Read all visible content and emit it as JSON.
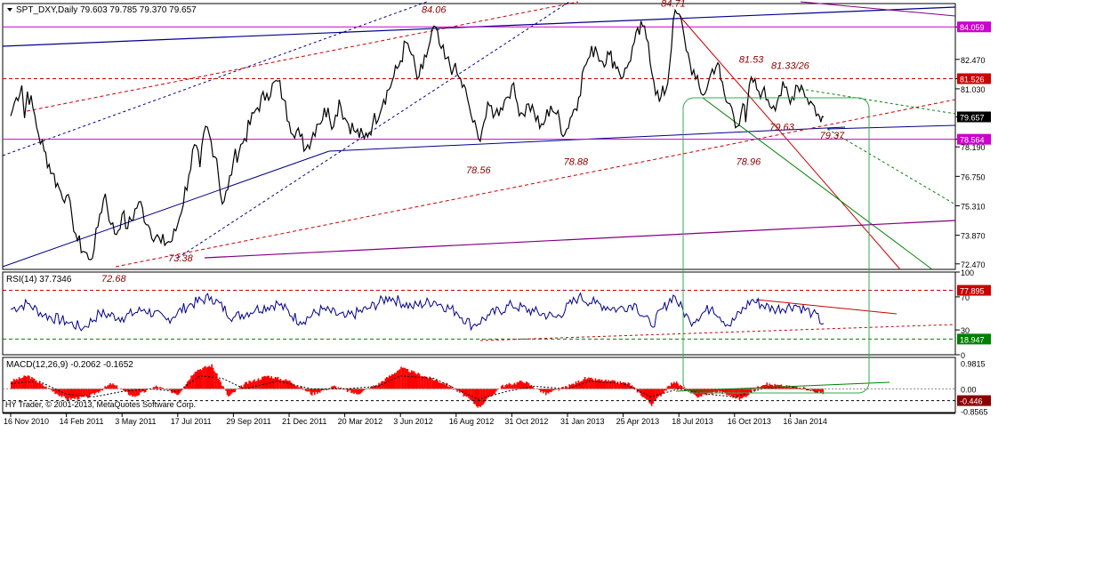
{
  "window": {
    "symbol_line": "SPT_DXY,Daily  79.603 79.785 79.370 79.657",
    "footer": "HY Trader, © 2001-2013, MetaQuotes Software Corp."
  },
  "colors": {
    "price": "#000000",
    "trend_blue": "#00008b",
    "trend_red": "#cc0000",
    "trend_green": "#008000",
    "magenta": "#cc00cc",
    "purple": "#800080",
    "box": "#33aa55",
    "macd_bars": "#ff0000",
    "annotation": "#8b0000"
  },
  "chart_data": [
    {
      "type": "line",
      "panel": "price",
      "title": "SPT_DXY,Daily  79.603 79.785 79.370 79.657",
      "x": [
        "16 Nov 2010",
        "14 Feb 2011",
        "3 May 2011",
        "17 Jul 2011",
        "29 Sep 2011",
        "21 Dec 2011",
        "20 Mar 2012",
        "3 Jun 2012",
        "16 Aug 2012",
        "31 Oct 2012",
        "31 Jan 2013",
        "25 Apr 2013",
        "18 Jul 2013",
        "16 Oct 2013",
        "16 Jan 2014"
      ],
      "ylim": [
        72.2,
        85.2
      ],
      "y_ticks": [
        "84.059",
        "82.470",
        "81.526",
        "81.030",
        "79.657",
        "78.564",
        "78.190",
        "76.750",
        "75.310",
        "73.870",
        "72.470"
      ],
      "highlighted_levels": [
        {
          "label": "84.059",
          "value": 84.059,
          "color": "#cc00cc"
        },
        {
          "label": "81.526",
          "value": 81.526,
          "color": "#cc0000"
        },
        {
          "label": "79.657",
          "value": 79.657,
          "color": "#000000"
        },
        {
          "label": "78.564",
          "value": 78.564,
          "color": "#cc00cc"
        }
      ],
      "series": [
        {
          "values": [
            [
              0,
              79.7
            ],
            [
              0.1,
              80.6
            ],
            [
              0.2,
              81.2
            ],
            [
              0.25,
              79.6
            ],
            [
              0.3,
              80.9
            ],
            [
              0.4,
              80.1
            ],
            [
              0.5,
              78.8
            ],
            [
              0.6,
              78.0
            ],
            [
              0.75,
              76.9
            ],
            [
              0.9,
              76.0
            ],
            [
              1.0,
              75.8
            ],
            [
              1.1,
              74.8
            ],
            [
              1.2,
              73.6
            ],
            [
              1.4,
              72.7
            ],
            [
              1.5,
              73.2
            ],
            [
              1.6,
              74.9
            ],
            [
              1.7,
              75.9
            ],
            [
              1.8,
              74.4
            ],
            [
              1.9,
              73.9
            ],
            [
              2.0,
              74.9
            ],
            [
              2.1,
              74.2
            ],
            [
              2.3,
              75.5
            ],
            [
              2.5,
              74.2
            ],
            [
              2.7,
              73.5
            ],
            [
              2.9,
              73.6
            ],
            [
              3.0,
              74.4
            ],
            [
              3.2,
              76.8
            ],
            [
              3.3,
              78.3
            ],
            [
              3.4,
              77.2
            ],
            [
              3.5,
              79.2
            ],
            [
              3.7,
              77.6
            ],
            [
              3.8,
              75.4
            ],
            [
              3.9,
              76.1
            ],
            [
              4.0,
              77.5
            ],
            [
              4.2,
              78.6
            ],
            [
              4.4,
              80.0
            ],
            [
              4.6,
              80.8
            ],
            [
              4.8,
              81.4
            ],
            [
              4.9,
              80.5
            ],
            [
              5.0,
              79.4
            ],
            [
              5.2,
              78.7
            ],
            [
              5.3,
              78.1
            ],
            [
              5.5,
              79.3
            ],
            [
              5.7,
              80.1
            ],
            [
              5.8,
              79.2
            ],
            [
              5.9,
              80.5
            ],
            [
              6.0,
              79.6
            ],
            [
              6.2,
              78.9
            ],
            [
              6.35,
              78.6
            ],
            [
              6.5,
              79.3
            ],
            [
              6.7,
              80.5
            ],
            [
              6.85,
              81.4
            ],
            [
              7.0,
              82.4
            ],
            [
              7.1,
              83.3
            ],
            [
              7.2,
              82.7
            ],
            [
              7.3,
              81.5
            ],
            [
              7.4,
              82.0
            ],
            [
              7.5,
              83.0
            ],
            [
              7.6,
              84.1
            ],
            [
              7.7,
              83.2
            ],
            [
              7.8,
              82.5
            ],
            [
              7.95,
              82.0
            ],
            [
              8.05,
              81.6
            ],
            [
              8.2,
              80.6
            ],
            [
              8.3,
              79.4
            ],
            [
              8.4,
              78.6
            ],
            [
              8.5,
              79.4
            ],
            [
              8.6,
              80.2
            ],
            [
              8.7,
              79.8
            ],
            [
              8.8,
              80.1
            ],
            [
              8.9,
              80.6
            ],
            [
              9.0,
              81.2
            ],
            [
              9.1,
              80.3
            ],
            [
              9.2,
              79.8
            ],
            [
              9.3,
              80.3
            ],
            [
              9.4,
              79.9
            ],
            [
              9.5,
              79.1
            ],
            [
              9.6,
              79.5
            ],
            [
              9.7,
              80.2
            ],
            [
              9.8,
              79.8
            ],
            [
              9.95,
              78.8
            ],
            [
              10.05,
              79.6
            ],
            [
              10.2,
              80.6
            ],
            [
              10.3,
              82.1
            ],
            [
              10.4,
              82.6
            ],
            [
              10.5,
              83.1
            ],
            [
              10.6,
              82.4
            ],
            [
              10.75,
              82.7
            ],
            [
              10.9,
              82.1
            ],
            [
              11.0,
              81.6
            ],
            [
              11.1,
              82.3
            ],
            [
              11.2,
              83.3
            ],
            [
              11.35,
              84.1
            ],
            [
              11.45,
              83.3
            ],
            [
              11.55,
              81.4
            ],
            [
              11.65,
              80.4
            ],
            [
              11.8,
              81.3
            ],
            [
              11.9,
              84.4
            ],
            [
              12.0,
              84.7
            ],
            [
              12.1,
              83.5
            ],
            [
              12.2,
              82.3
            ],
            [
              12.3,
              81.5
            ],
            [
              12.4,
              80.8
            ],
            [
              12.5,
              81.0
            ],
            [
              12.6,
              82.0
            ],
            [
              12.7,
              82.3
            ],
            [
              12.75,
              81.5
            ],
            [
              12.85,
              80.4
            ],
            [
              12.95,
              80.1
            ],
            [
              13.05,
              79.2
            ],
            [
              13.15,
              80.3
            ],
            [
              13.2,
              79.4
            ],
            [
              13.3,
              81.6
            ],
            [
              13.4,
              81.0
            ],
            [
              13.5,
              80.9
            ],
            [
              13.6,
              80.5
            ],
            [
              13.7,
              80.2
            ],
            [
              13.8,
              80.7
            ],
            [
              13.9,
              81.1
            ],
            [
              14.0,
              80.3
            ],
            [
              14.1,
              81.2
            ],
            [
              14.2,
              81.2
            ],
            [
              14.3,
              80.6
            ],
            [
              14.4,
              80.3
            ],
            [
              14.5,
              79.8
            ],
            [
              14.55,
              79.4
            ],
            [
              14.6,
              79.66
            ]
          ]
        }
      ],
      "annotations": [
        "84.06",
        "84.71",
        "81.53",
        "81.33/26",
        "79.63",
        "79.37",
        "78.56",
        "78.88",
        "78.96",
        "72.68",
        "73.38"
      ]
    },
    {
      "type": "line",
      "panel": "rsi",
      "title": "RSI(14) 37.7346",
      "ylim": [
        0,
        100
      ],
      "y_ticks": [
        "100",
        "70",
        "30",
        "0"
      ],
      "highlighted_levels": [
        {
          "label": "77.895",
          "value": 77.895,
          "color": "#cc0000"
        },
        {
          "label": "18.947",
          "value": 18.947,
          "color": "#008000"
        }
      ],
      "series": [
        {
          "values": [
            [
              0,
              55
            ],
            [
              0.3,
              62
            ],
            [
              0.6,
              48
            ],
            [
              1.0,
              40
            ],
            [
              1.3,
              32
            ],
            [
              1.6,
              50
            ],
            [
              2.0,
              45
            ],
            [
              2.4,
              55
            ],
            [
              2.8,
              42
            ],
            [
              3.2,
              60
            ],
            [
              3.6,
              70
            ],
            [
              4.0,
              45
            ],
            [
              4.4,
              55
            ],
            [
              4.8,
              62
            ],
            [
              5.2,
              40
            ],
            [
              5.6,
              55
            ],
            [
              6.0,
              45
            ],
            [
              6.4,
              55
            ],
            [
              6.8,
              70
            ],
            [
              7.2,
              58
            ],
            [
              7.6,
              65
            ],
            [
              8.0,
              52
            ],
            [
              8.3,
              35
            ],
            [
              8.6,
              48
            ],
            [
              9.0,
              60
            ],
            [
              9.4,
              52
            ],
            [
              9.8,
              45
            ],
            [
              10.2,
              70
            ],
            [
              10.5,
              62
            ],
            [
              10.9,
              55
            ],
            [
              11.2,
              62
            ],
            [
              11.5,
              35
            ],
            [
              11.9,
              72
            ],
            [
              12.2,
              40
            ],
            [
              12.6,
              58
            ],
            [
              12.9,
              35
            ],
            [
              13.3,
              66
            ],
            [
              13.7,
              55
            ],
            [
              14.1,
              60
            ],
            [
              14.4,
              50
            ],
            [
              14.6,
              37.7
            ]
          ]
        }
      ]
    },
    {
      "type": "bar",
      "panel": "macd",
      "title": "MACD(12,26,9) -0.2062 -0.1652",
      "ylim": [
        -0.9,
        1.2
      ],
      "y_ticks": [
        "0.9815",
        "0.00",
        "-0.8565"
      ],
      "highlighted_levels": [
        {
          "label": "-0.446",
          "value": -0.446,
          "color": "#8b0000"
        }
      ],
      "series": [
        {
          "values": [
            [
              0,
              0.3
            ],
            [
              0.3,
              0.5
            ],
            [
              0.6,
              0.1
            ],
            [
              1.0,
              -0.4
            ],
            [
              1.4,
              -0.3
            ],
            [
              1.8,
              0.2
            ],
            [
              2.2,
              -0.3
            ],
            [
              2.6,
              0.1
            ],
            [
              3.0,
              -0.2
            ],
            [
              3.3,
              0.7
            ],
            [
              3.6,
              0.9
            ],
            [
              3.9,
              -0.3
            ],
            [
              4.2,
              0.2
            ],
            [
              4.6,
              0.5
            ],
            [
              5.0,
              0.3
            ],
            [
              5.4,
              -0.2
            ],
            [
              5.8,
              0.1
            ],
            [
              6.2,
              -0.2
            ],
            [
              6.6,
              0.2
            ],
            [
              7.0,
              0.8
            ],
            [
              7.4,
              0.5
            ],
            [
              7.8,
              0.2
            ],
            [
              8.1,
              -0.2
            ],
            [
              8.4,
              -0.7
            ],
            [
              8.8,
              0.1
            ],
            [
              9.2,
              0.3
            ],
            [
              9.6,
              -0.2
            ],
            [
              10.0,
              0.1
            ],
            [
              10.3,
              0.4
            ],
            [
              10.7,
              0.3
            ],
            [
              11.1,
              0.2
            ],
            [
              11.5,
              -0.6
            ],
            [
              11.9,
              0.3
            ],
            [
              12.3,
              -0.3
            ],
            [
              12.7,
              -0.1
            ],
            [
              13.1,
              -0.4
            ],
            [
              13.5,
              0.2
            ],
            [
              13.9,
              0.1
            ],
            [
              14.3,
              0.0
            ],
            [
              14.6,
              -0.2
            ]
          ]
        },
        {
          "values": [
            [
              0,
              0.2
            ],
            [
              0.5,
              0.3
            ],
            [
              1.0,
              -0.2
            ],
            [
              1.5,
              -0.3
            ],
            [
              2.0,
              -0.1
            ],
            [
              2.5,
              0.0
            ],
            [
              3.0,
              -0.1
            ],
            [
              3.4,
              0.5
            ],
            [
              3.8,
              0.4
            ],
            [
              4.2,
              0.0
            ],
            [
              4.8,
              0.3
            ],
            [
              5.4,
              0.0
            ],
            [
              6.0,
              0.0
            ],
            [
              6.6,
              0.1
            ],
            [
              7.0,
              0.5
            ],
            [
              7.6,
              0.4
            ],
            [
              8.0,
              0.0
            ],
            [
              8.4,
              -0.4
            ],
            [
              8.9,
              -0.1
            ],
            [
              9.4,
              0.1
            ],
            [
              10.0,
              0.0
            ],
            [
              10.4,
              0.3
            ],
            [
              11.0,
              0.2
            ],
            [
              11.5,
              -0.3
            ],
            [
              12.0,
              0.0
            ],
            [
              12.5,
              -0.2
            ],
            [
              13.0,
              -0.3
            ],
            [
              13.5,
              0.0
            ],
            [
              14.0,
              0.1
            ],
            [
              14.6,
              -0.16
            ]
          ]
        }
      ]
    }
  ]
}
